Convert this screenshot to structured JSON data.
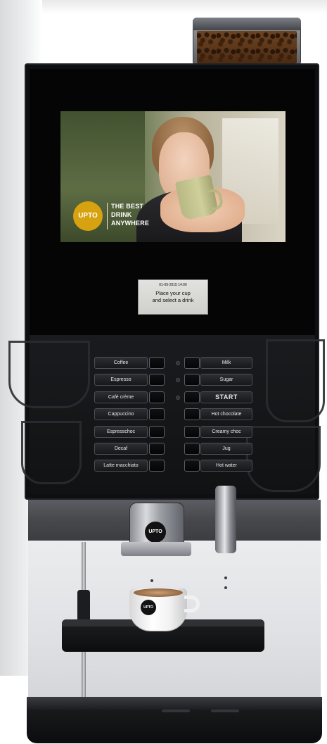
{
  "screen": {
    "brand_logo_text": "UPTO",
    "tagline_line1": "THE BEST",
    "tagline_line2": "DRINK",
    "tagline_line3": "ANYWHERE"
  },
  "status": {
    "date": "01-09-2015 14:00",
    "message_line1": "Place your cup",
    "message_line2": "and select a drink"
  },
  "left_buttons": [
    {
      "label": "Coffee"
    },
    {
      "label": "Espresso"
    },
    {
      "label": "Café crème"
    },
    {
      "label": "Cappuccino"
    },
    {
      "label": "Espresschoc"
    },
    {
      "label": "Decaf"
    },
    {
      "label": "Latte macchiato"
    }
  ],
  "right_buttons": [
    {
      "label": "Milk"
    },
    {
      "label": "Sugar"
    },
    {
      "label": "START"
    },
    {
      "label": "Hot chocolate"
    },
    {
      "label": "Creamy choc"
    },
    {
      "label": "Jug"
    },
    {
      "label": "Hot water"
    }
  ],
  "spout": {
    "logo_text": "UPTO"
  },
  "cup": {
    "logo_text": "UPTO"
  },
  "colors": {
    "brand_yellow": "#d7a20f",
    "machine_black": "#0e0f11",
    "panel_gray": "#4a4c50",
    "steel": "#c5c7ca"
  }
}
